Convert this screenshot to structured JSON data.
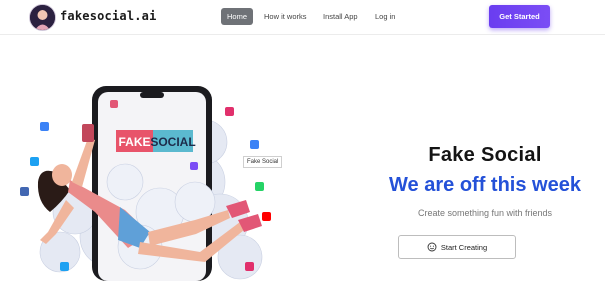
{
  "header": {
    "brand": "fakesocial.ai",
    "nav": [
      {
        "label": "Home",
        "active": true
      },
      {
        "label": "How it works",
        "active": false
      },
      {
        "label": "Install App",
        "active": false
      },
      {
        "label": "Log in",
        "active": false
      }
    ],
    "cta_label": "Get Started"
  },
  "hero": {
    "phone_text_fake": "FAKE",
    "phone_text_social": "SOCIAL",
    "floating_label": "Fake Social",
    "title": "Fake Social",
    "subtitle": "We are off this week",
    "tagline": "Create something fun with friends",
    "button_label": "Start Creating"
  },
  "colors": {
    "accent": "#6a3df0",
    "subtitle": "#2451d8",
    "nav_active": "#6f7277"
  }
}
